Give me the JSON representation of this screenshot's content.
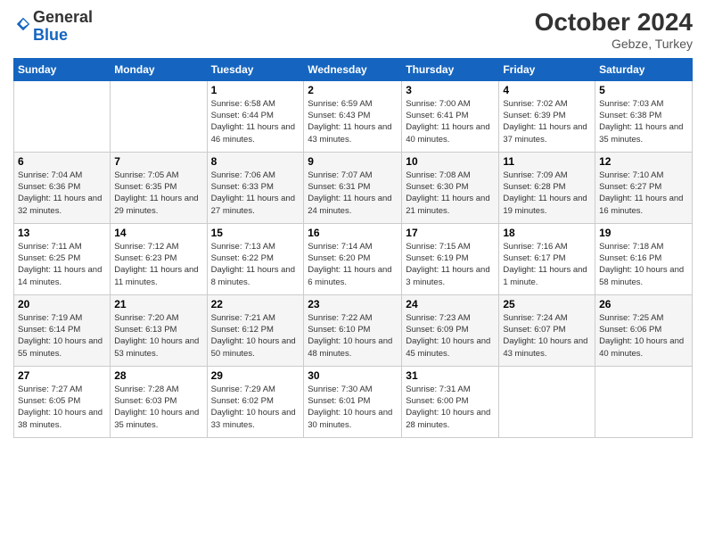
{
  "logo": {
    "general": "General",
    "blue": "Blue"
  },
  "header": {
    "month": "October 2024",
    "location": "Gebze, Turkey"
  },
  "weekdays": [
    "Sunday",
    "Monday",
    "Tuesday",
    "Wednesday",
    "Thursday",
    "Friday",
    "Saturday"
  ],
  "weeks": [
    [
      {
        "day": "",
        "info": ""
      },
      {
        "day": "",
        "info": ""
      },
      {
        "day": "1",
        "info": "Sunrise: 6:58 AM\nSunset: 6:44 PM\nDaylight: 11 hours and 46 minutes."
      },
      {
        "day": "2",
        "info": "Sunrise: 6:59 AM\nSunset: 6:43 PM\nDaylight: 11 hours and 43 minutes."
      },
      {
        "day": "3",
        "info": "Sunrise: 7:00 AM\nSunset: 6:41 PM\nDaylight: 11 hours and 40 minutes."
      },
      {
        "day": "4",
        "info": "Sunrise: 7:02 AM\nSunset: 6:39 PM\nDaylight: 11 hours and 37 minutes."
      },
      {
        "day": "5",
        "info": "Sunrise: 7:03 AM\nSunset: 6:38 PM\nDaylight: 11 hours and 35 minutes."
      }
    ],
    [
      {
        "day": "6",
        "info": "Sunrise: 7:04 AM\nSunset: 6:36 PM\nDaylight: 11 hours and 32 minutes."
      },
      {
        "day": "7",
        "info": "Sunrise: 7:05 AM\nSunset: 6:35 PM\nDaylight: 11 hours and 29 minutes."
      },
      {
        "day": "8",
        "info": "Sunrise: 7:06 AM\nSunset: 6:33 PM\nDaylight: 11 hours and 27 minutes."
      },
      {
        "day": "9",
        "info": "Sunrise: 7:07 AM\nSunset: 6:31 PM\nDaylight: 11 hours and 24 minutes."
      },
      {
        "day": "10",
        "info": "Sunrise: 7:08 AM\nSunset: 6:30 PM\nDaylight: 11 hours and 21 minutes."
      },
      {
        "day": "11",
        "info": "Sunrise: 7:09 AM\nSunset: 6:28 PM\nDaylight: 11 hours and 19 minutes."
      },
      {
        "day": "12",
        "info": "Sunrise: 7:10 AM\nSunset: 6:27 PM\nDaylight: 11 hours and 16 minutes."
      }
    ],
    [
      {
        "day": "13",
        "info": "Sunrise: 7:11 AM\nSunset: 6:25 PM\nDaylight: 11 hours and 14 minutes."
      },
      {
        "day": "14",
        "info": "Sunrise: 7:12 AM\nSunset: 6:23 PM\nDaylight: 11 hours and 11 minutes."
      },
      {
        "day": "15",
        "info": "Sunrise: 7:13 AM\nSunset: 6:22 PM\nDaylight: 11 hours and 8 minutes."
      },
      {
        "day": "16",
        "info": "Sunrise: 7:14 AM\nSunset: 6:20 PM\nDaylight: 11 hours and 6 minutes."
      },
      {
        "day": "17",
        "info": "Sunrise: 7:15 AM\nSunset: 6:19 PM\nDaylight: 11 hours and 3 minutes."
      },
      {
        "day": "18",
        "info": "Sunrise: 7:16 AM\nSunset: 6:17 PM\nDaylight: 11 hours and 1 minute."
      },
      {
        "day": "19",
        "info": "Sunrise: 7:18 AM\nSunset: 6:16 PM\nDaylight: 10 hours and 58 minutes."
      }
    ],
    [
      {
        "day": "20",
        "info": "Sunrise: 7:19 AM\nSunset: 6:14 PM\nDaylight: 10 hours and 55 minutes."
      },
      {
        "day": "21",
        "info": "Sunrise: 7:20 AM\nSunset: 6:13 PM\nDaylight: 10 hours and 53 minutes."
      },
      {
        "day": "22",
        "info": "Sunrise: 7:21 AM\nSunset: 6:12 PM\nDaylight: 10 hours and 50 minutes."
      },
      {
        "day": "23",
        "info": "Sunrise: 7:22 AM\nSunset: 6:10 PM\nDaylight: 10 hours and 48 minutes."
      },
      {
        "day": "24",
        "info": "Sunrise: 7:23 AM\nSunset: 6:09 PM\nDaylight: 10 hours and 45 minutes."
      },
      {
        "day": "25",
        "info": "Sunrise: 7:24 AM\nSunset: 6:07 PM\nDaylight: 10 hours and 43 minutes."
      },
      {
        "day": "26",
        "info": "Sunrise: 7:25 AM\nSunset: 6:06 PM\nDaylight: 10 hours and 40 minutes."
      }
    ],
    [
      {
        "day": "27",
        "info": "Sunrise: 7:27 AM\nSunset: 6:05 PM\nDaylight: 10 hours and 38 minutes."
      },
      {
        "day": "28",
        "info": "Sunrise: 7:28 AM\nSunset: 6:03 PM\nDaylight: 10 hours and 35 minutes."
      },
      {
        "day": "29",
        "info": "Sunrise: 7:29 AM\nSunset: 6:02 PM\nDaylight: 10 hours and 33 minutes."
      },
      {
        "day": "30",
        "info": "Sunrise: 7:30 AM\nSunset: 6:01 PM\nDaylight: 10 hours and 30 minutes."
      },
      {
        "day": "31",
        "info": "Sunrise: 7:31 AM\nSunset: 6:00 PM\nDaylight: 10 hours and 28 minutes."
      },
      {
        "day": "",
        "info": ""
      },
      {
        "day": "",
        "info": ""
      }
    ]
  ]
}
